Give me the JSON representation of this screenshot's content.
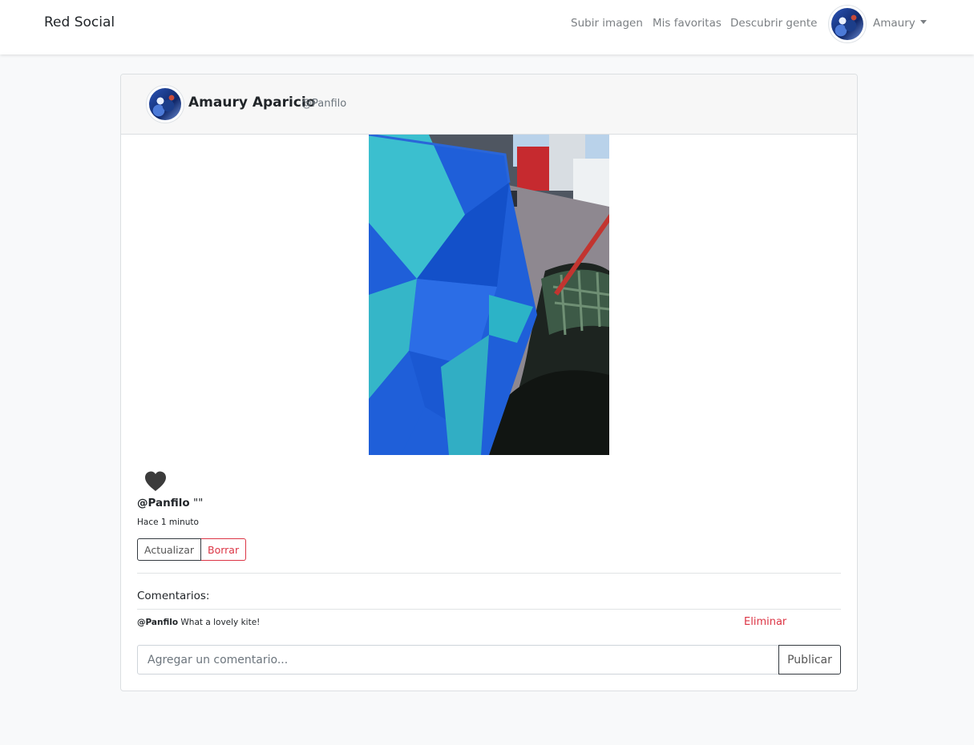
{
  "navbar": {
    "brand": "Red Social",
    "links": [
      "Subir imagen",
      "Mis favoritas",
      "Descubrir gente"
    ],
    "user_label": "Amaury"
  },
  "post": {
    "author_name": "Amaury Aparicio",
    "author_handle": "@Panfilo",
    "caption_handle": "@Panfilo",
    "caption_text": "\"\"",
    "timestamp": "Hace 1 minuto",
    "update_label": "Actualizar",
    "delete_label": "Borrar",
    "like_icon": "heart-icon",
    "comments_title": "Comentarios:",
    "comments": [
      {
        "handle": "@Panfilo",
        "text": "What a lovely kite!",
        "delete_label": "Eliminar"
      }
    ],
    "comment_placeholder": "Agregar un comentario...",
    "publish_label": "Publicar"
  },
  "colors": {
    "accent_red": "#dc3545",
    "border_dark": "#343a40",
    "navbar_bg": "#ffffff",
    "page_bg": "#f8f9fa"
  }
}
